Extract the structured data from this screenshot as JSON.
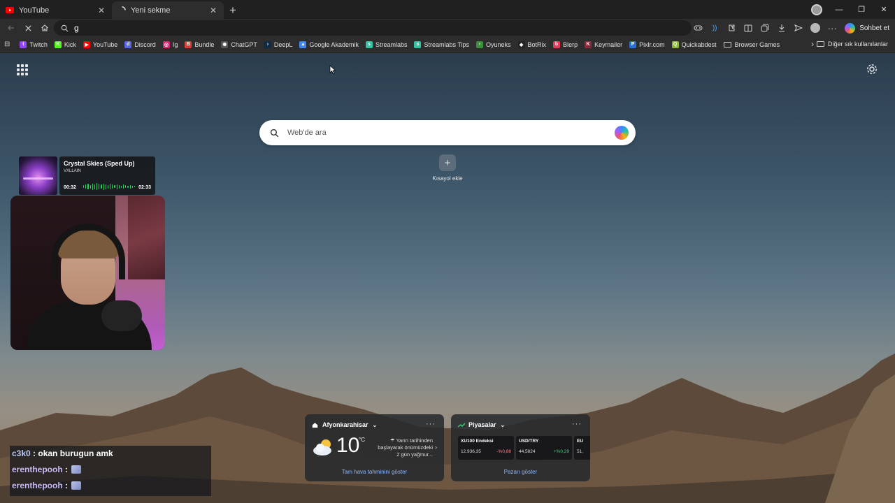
{
  "tabs": [
    {
      "title": "YouTube",
      "active": false,
      "favicon": "youtube-icon",
      "color": "#ff0000"
    },
    {
      "title": "Yeni sekme",
      "active": true,
      "favicon": "loading-spinner-icon"
    }
  ],
  "omnibox": {
    "value": "g"
  },
  "toolbar": {
    "copilot_label": "Sohbet et"
  },
  "bookmarks": {
    "items": [
      {
        "label": "Twitch",
        "icon": "twitch-icon",
        "color": "#9146ff",
        "glyph": "t"
      },
      {
        "label": "Kick",
        "icon": "kick-icon",
        "color": "#53fc18",
        "glyph": "K"
      },
      {
        "label": "YouTube",
        "icon": "youtube-icon",
        "color": "#ff0000",
        "glyph": "▶"
      },
      {
        "label": "Discord",
        "icon": "discord-icon",
        "color": "#5865f2",
        "glyph": "d"
      },
      {
        "label": "Ig",
        "icon": "instagram-icon",
        "color": "#d62976",
        "glyph": "◎"
      },
      {
        "label": "Bundle",
        "icon": "bundle-icon",
        "color": "#e23b3b",
        "glyph": "B"
      },
      {
        "label": "ChatGPT",
        "icon": "chatgpt-icon",
        "color": "#555555",
        "glyph": "✺"
      },
      {
        "label": "DeepL",
        "icon": "deepl-icon",
        "color": "#0f2b46",
        "glyph": "›"
      },
      {
        "label": "Google Akademik",
        "icon": "google-scholar-icon",
        "color": "#4285f4",
        "glyph": "▲"
      },
      {
        "label": "Streamlabs",
        "icon": "streamlabs-icon",
        "color": "#31c3a2",
        "glyph": "s"
      },
      {
        "label": "Streamlabs Tips",
        "icon": "streamlabs-tips-icon",
        "color": "#31c3a2",
        "glyph": "s"
      },
      {
        "label": "Oyuneks",
        "icon": "oyuneks-icon",
        "color": "#3e8e3e",
        "glyph": "♀"
      },
      {
        "label": "BotRix",
        "icon": "botrix-icon",
        "color": "#222222",
        "glyph": "◆"
      },
      {
        "label": "Blerp",
        "icon": "blerp-icon",
        "color": "#e63a5a",
        "glyph": "b"
      },
      {
        "label": "Keymailer",
        "icon": "keymailer-icon",
        "color": "#8a2b3b",
        "glyph": "K"
      },
      {
        "label": "Pixlr.com",
        "icon": "pixlr-icon",
        "color": "#2a6fd6",
        "glyph": "P"
      },
      {
        "label": "Quickabdest",
        "icon": "quickabdest-icon",
        "color": "#8fb83a",
        "glyph": "Q"
      },
      {
        "label": "Browser Games",
        "icon": "folder-icon",
        "color": "#2d2d2d",
        "glyph": ""
      }
    ],
    "other_label": "Diğer sık kullanılanlar"
  },
  "ntp": {
    "search_placeholder": "Web'de ara",
    "shortcut_label": "Kısayol ekle"
  },
  "now_playing": {
    "title": "Crystal Skies (Sped Up)",
    "artist": "VXLLAIN",
    "elapsed": "00:32",
    "duration": "02:33"
  },
  "chat": [
    {
      "user": "c3k0",
      "sep": " : ",
      "message": "okan burugun amk",
      "emote": false
    },
    {
      "user": "erenthepooh",
      "sep": " : ",
      "message": "",
      "emote": true
    },
    {
      "user": "erenthepooh",
      "sep": " : ",
      "message": "",
      "emote": true
    }
  ],
  "weather": {
    "location": "Afyonkarahisar",
    "temp": "10",
    "unit": "°C",
    "forecast_lines": [
      "Yarın tarihinden",
      "başlayarak önümüzdeki",
      "2 gün yağmur..."
    ],
    "link": "Tam hava tahminini göster"
  },
  "markets": {
    "title": "Piyasalar",
    "stocks": [
      {
        "name": "XU100 Endeksi",
        "value": "12.936,35",
        "change": "-%0,88",
        "direction": "down"
      },
      {
        "name": "USD/TRY",
        "value": "44,5824",
        "change": "+%0,29",
        "direction": "up"
      },
      {
        "name": "EU",
        "value": "51,",
        "change": "",
        "direction": "up"
      }
    ],
    "link": "Pazarı göster"
  }
}
